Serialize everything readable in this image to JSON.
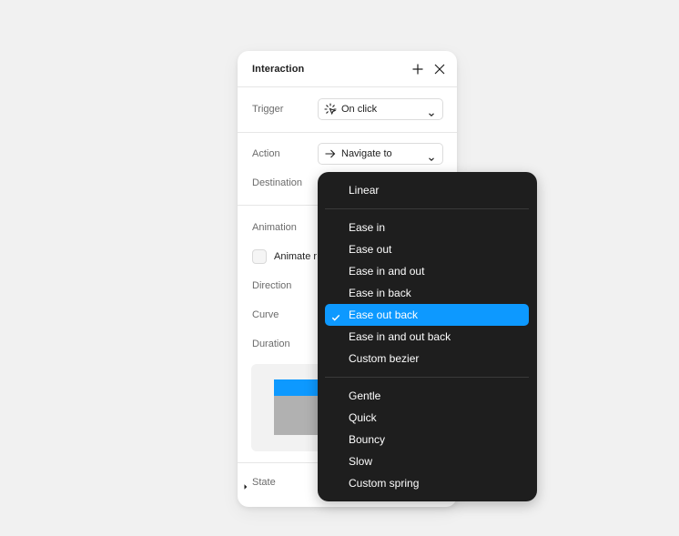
{
  "panel": {
    "title": "Interaction",
    "trigger": {
      "label": "Trigger",
      "value": "On click",
      "icon": "click-icon"
    },
    "action": {
      "label": "Action",
      "value": "Navigate to",
      "icon": "arrow-right-icon"
    },
    "destination": {
      "label": "Destination"
    },
    "animation": {
      "label": "Animation",
      "checkbox_label": "Animate r",
      "direction_label": "Direction",
      "curve_label": "Curve",
      "duration_label": "Duration"
    },
    "state": {
      "label": "State"
    }
  },
  "menu": {
    "group1": [
      "Linear"
    ],
    "group2": [
      "Ease in",
      "Ease out",
      "Ease in and out",
      "Ease in back",
      "Ease out back",
      "Ease in and out back",
      "Custom bezier"
    ],
    "group3": [
      "Gentle",
      "Quick",
      "Bouncy",
      "Slow",
      "Custom spring"
    ],
    "selected": "Ease out back"
  },
  "colors": {
    "accent": "#0d99ff",
    "menu_bg": "#1e1e1e",
    "preview_frame": "#b1b1b1"
  }
}
